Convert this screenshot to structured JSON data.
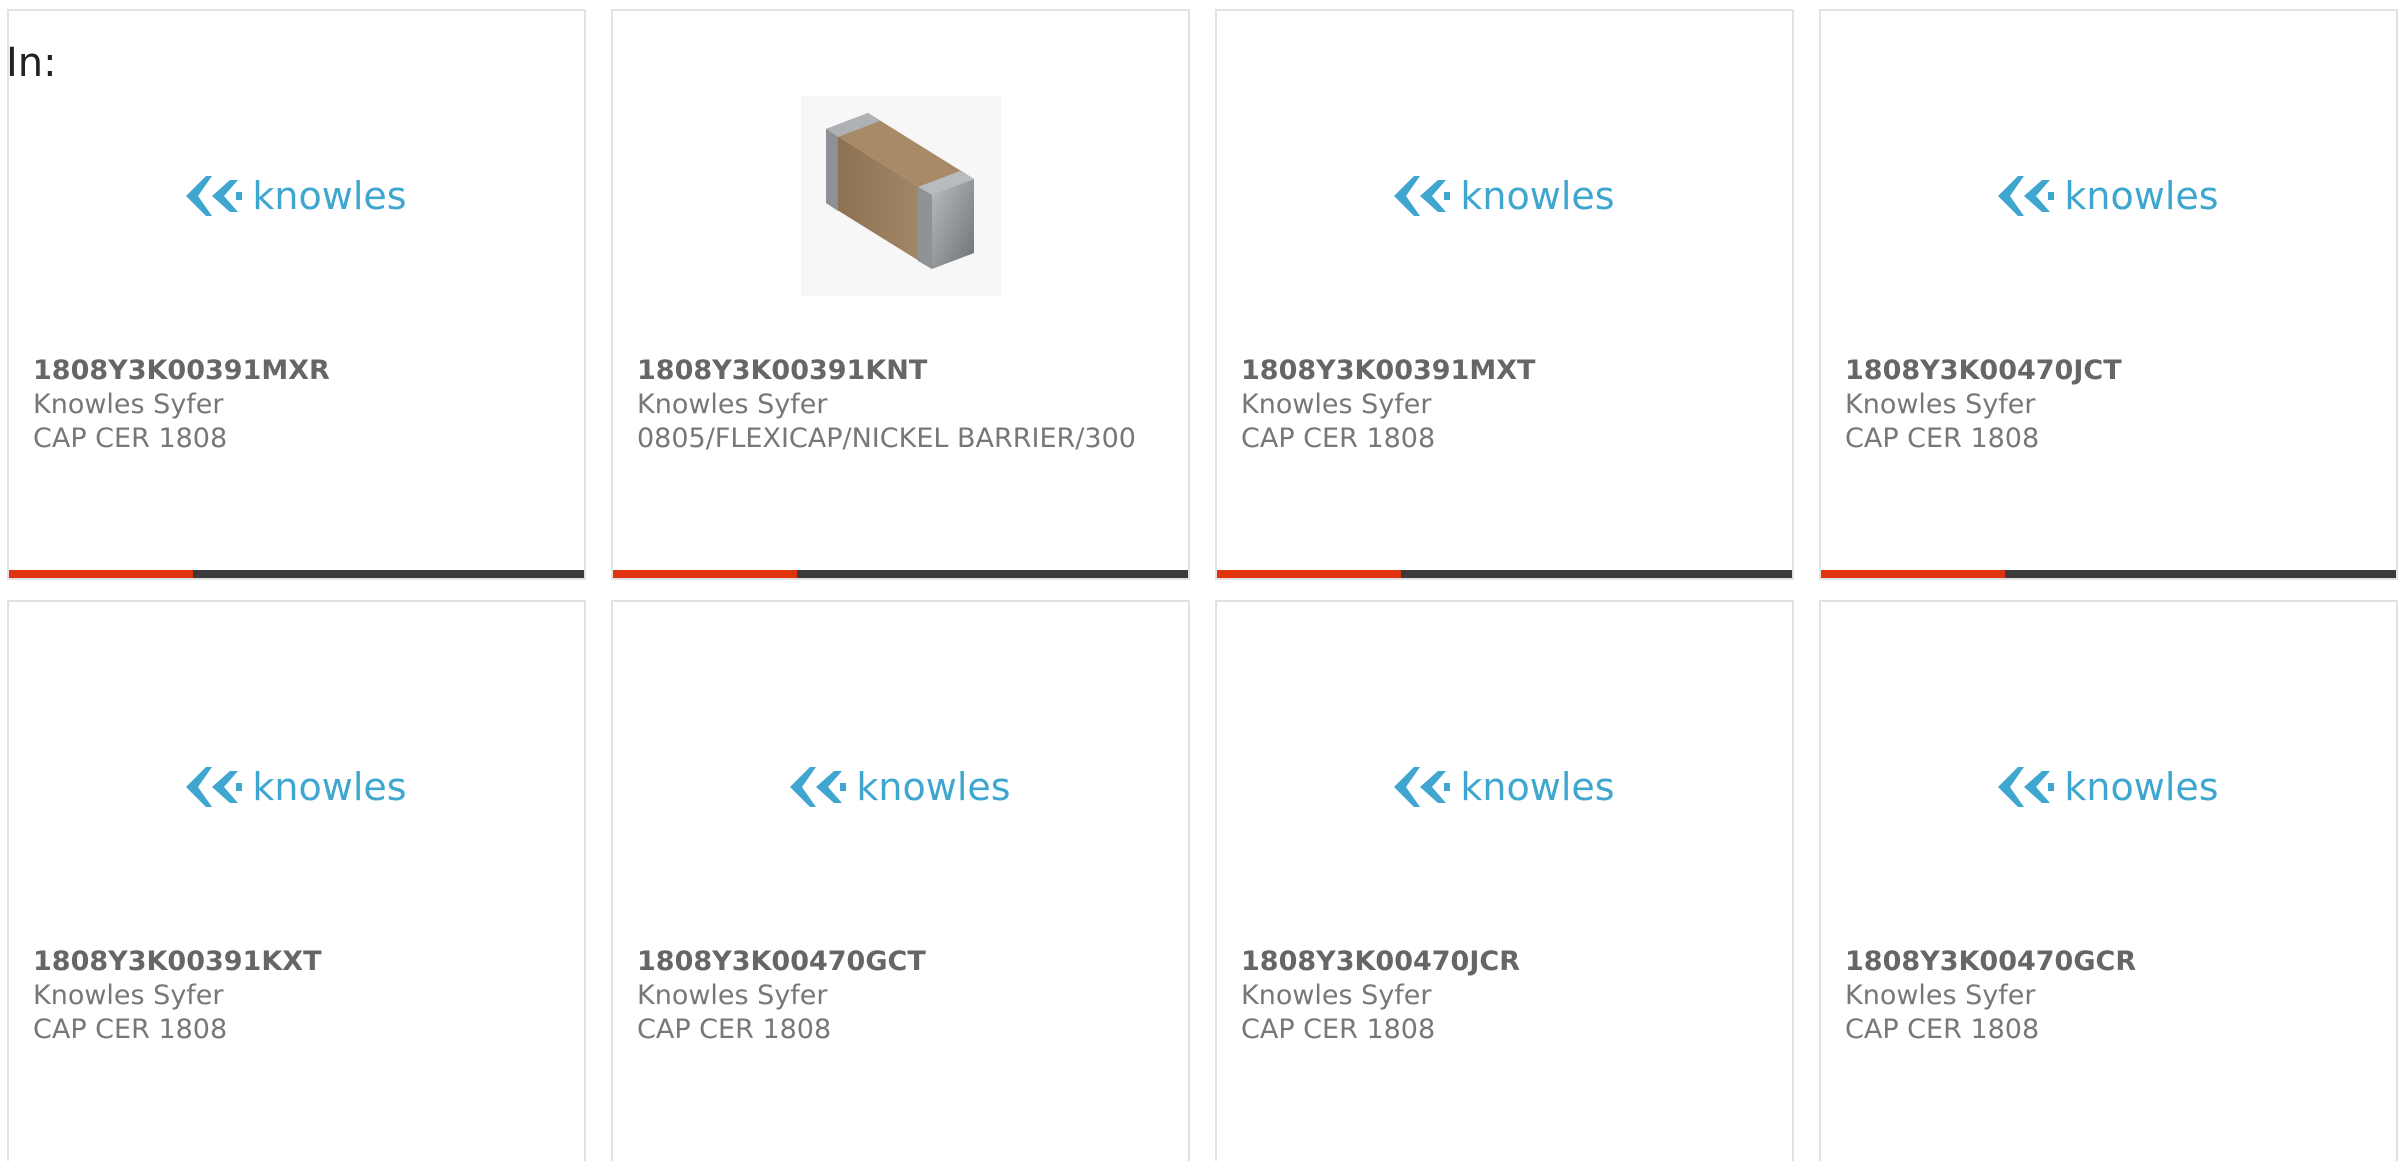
{
  "header": {
    "in_label": "In:"
  },
  "colors": {
    "accent": "#e0340f",
    "bar_track": "#3b3b3b",
    "logo_blue": "#3fa6cf",
    "text_gray": "#777777"
  },
  "logo": {
    "text": "knowles",
    "icon": "knowles-logo-icon"
  },
  "products": [
    {
      "part_number": "1808Y3K00391MXR",
      "manufacturer": "Knowles Syfer",
      "description": "CAP CER 1808",
      "image": "knowles-logo",
      "progress": 0.32
    },
    {
      "part_number": "1808Y3K00391KNT",
      "manufacturer": "Knowles Syfer",
      "description": "0805/FLEXICAP/NICKEL BARRIER/300",
      "image": "capacitor-chip",
      "progress": 0.32
    },
    {
      "part_number": "1808Y3K00391MXT",
      "manufacturer": "Knowles Syfer",
      "description": "CAP CER 1808",
      "image": "knowles-logo",
      "progress": 0.32
    },
    {
      "part_number": "1808Y3K00470JCT",
      "manufacturer": "Knowles Syfer",
      "description": "CAP CER 1808",
      "image": "knowles-logo",
      "progress": 0.32
    },
    {
      "part_number": "1808Y3K00391KXT",
      "manufacturer": "Knowles Syfer",
      "description": "CAP CER 1808",
      "image": "knowles-logo"
    },
    {
      "part_number": "1808Y3K00470GCT",
      "manufacturer": "Knowles Syfer",
      "description": "CAP CER 1808",
      "image": "knowles-logo"
    },
    {
      "part_number": "1808Y3K00470JCR",
      "manufacturer": "Knowles Syfer",
      "description": "CAP CER 1808",
      "image": "knowles-logo"
    },
    {
      "part_number": "1808Y3K00470GCR",
      "manufacturer": "Knowles Syfer",
      "description": "CAP CER 1808",
      "image": "knowles-logo"
    }
  ]
}
